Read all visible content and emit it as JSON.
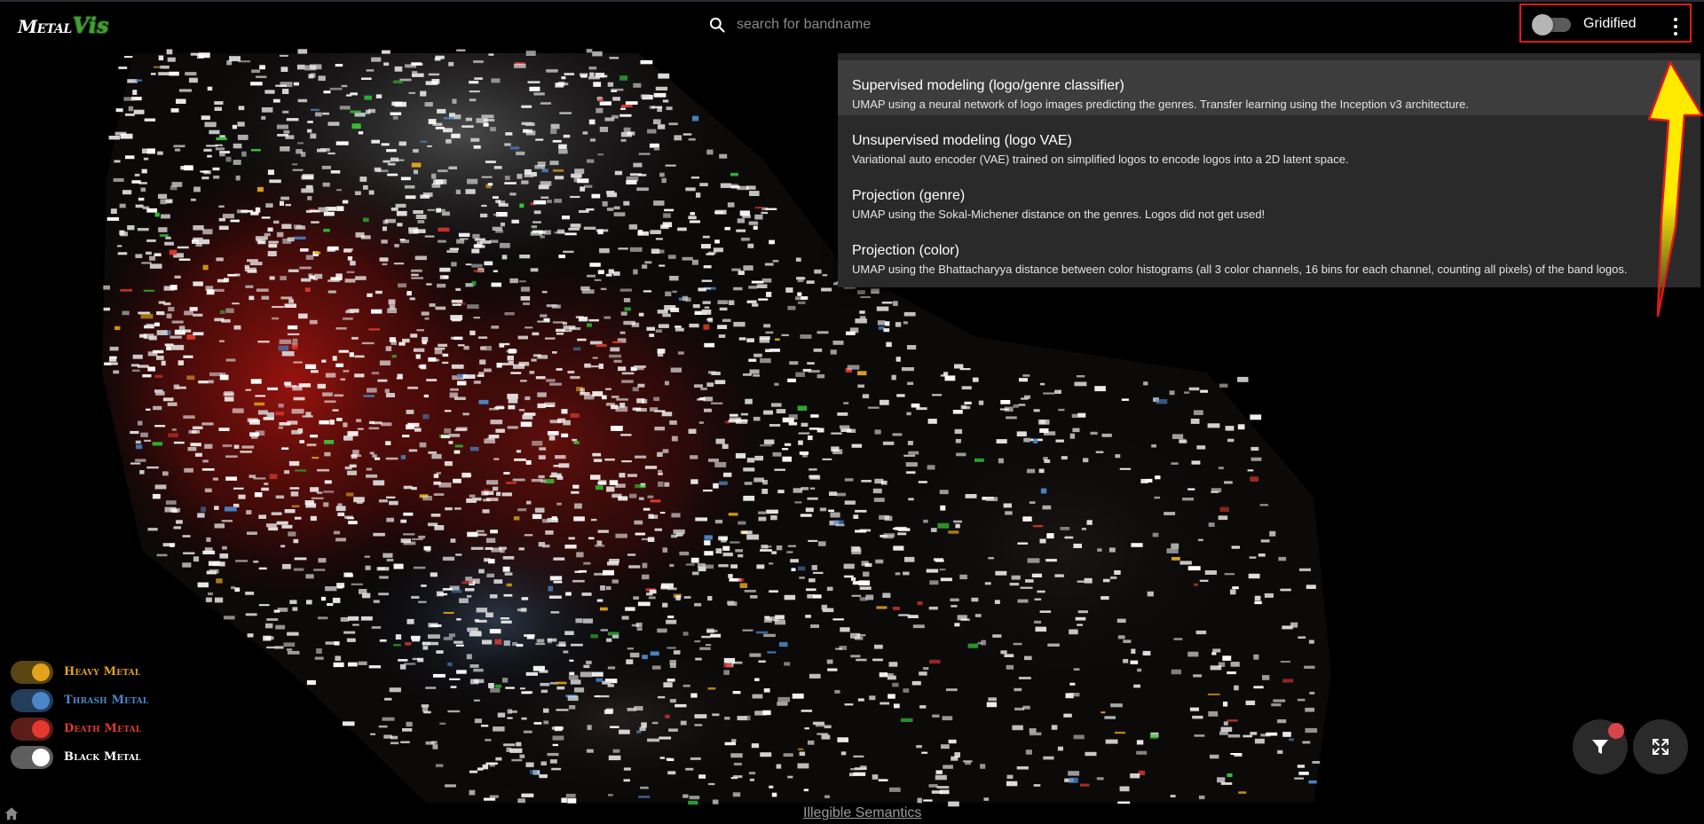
{
  "app": {
    "logo_part1": "Metal",
    "logo_part2": "Vis"
  },
  "search": {
    "placeholder": "search for bandname",
    "value": ""
  },
  "toolbar": {
    "gridified_label": "Gridified",
    "gridified_on": false
  },
  "menu": {
    "items": [
      {
        "title": "Supervised modeling (logo/genre classifier)",
        "description": "UMAP using a neural network of logo images predicting the genres. Transfer learning using the Inception v3 architecture.",
        "highlighted": true
      },
      {
        "title": "Unsupervised modeling (logo VAE)",
        "description": "Variational auto encoder (VAE) trained on simplified logos to encode logos into a 2D latent space.",
        "highlighted": false
      },
      {
        "title": "Projection (genre)",
        "description": "UMAP using the Sokal-Michener distance on the genres. Logos did not get used!",
        "highlighted": false
      },
      {
        "title": "Projection (color)",
        "description": "UMAP using the Bhattacharyya distance between color histograms (all 3 color channels, 16 bins for each channel, counting all pixels) of the band logos.",
        "highlighted": false
      }
    ]
  },
  "legend": {
    "items": [
      {
        "label": "Heavy Metal",
        "color": "#e0a31b",
        "track": "#5a4512",
        "on": true
      },
      {
        "label": "Thrash Metal",
        "color": "#4a86c8",
        "track": "#243d5a",
        "on": true
      },
      {
        "label": "Death Metal",
        "color": "#e23a2f",
        "track": "#5c1d18",
        "on": true
      },
      {
        "label": "Black Metal",
        "color": "#ffffff",
        "track": "#5e5e5e",
        "on": true
      }
    ]
  },
  "footer": {
    "link_text": "Illegible Semantics"
  },
  "icons": {
    "search": "search-icon",
    "menu": "more-vert-icon",
    "filter": "filter-icon",
    "fullscreen": "fullscreen-icon",
    "home": "home-icon"
  },
  "colors": {
    "annotation_box": "#e01919",
    "arrow_fill": "#ffea00",
    "arrow_stroke": "#e01919",
    "badge": "#d9434a"
  }
}
